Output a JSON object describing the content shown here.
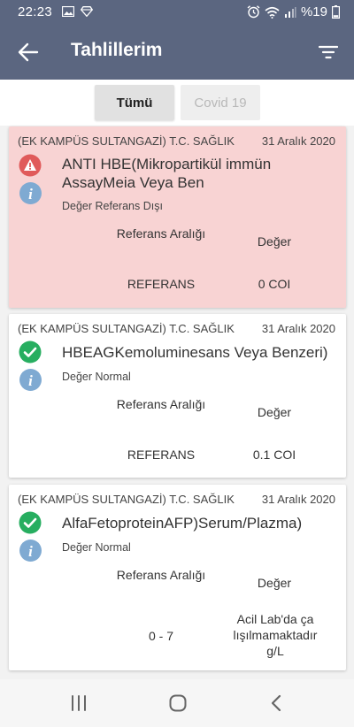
{
  "status_bar": {
    "time": "22:23",
    "battery_text": "%19",
    "icons": [
      "image-icon",
      "diamond-icon",
      "alarm-icon",
      "wifi-icon",
      "signal-icon",
      "battery-icon"
    ]
  },
  "header": {
    "title": "Tahlillerim",
    "back_icon": "arrow-left-icon",
    "filter_icon": "filter-icon"
  },
  "tabs": [
    {
      "label": "Tümü",
      "selected": true
    },
    {
      "label": "Covid 19",
      "selected": false
    }
  ],
  "colors": {
    "primary": "#5b6680",
    "alert_card_bg": "#f8d3d3",
    "warning_icon": "#e05a5a",
    "check_icon": "#27ae60",
    "info_icon": "#7faad2"
  },
  "results": [
    {
      "institution": "(EK KAMPÜS SULTANGAZİ) T.C. SAĞLIK",
      "date": "31 Aralık 2020",
      "test_name": "ANTI HBE(Mikropartikül immün AssayMeia Veya Ben",
      "status_text": "Değer Referans Dışı",
      "status_icon": "warning-icon",
      "ref_header": "Referans Aralığı",
      "value_header": "Değer",
      "ref_value": "REFERANS",
      "value": "0 COI"
    },
    {
      "institution": "(EK KAMPÜS SULTANGAZİ) T.C. SAĞLIK",
      "date": "31 Aralık 2020",
      "test_name": "HBEAGKemoluminesans Veya Benzeri)",
      "status_text": "Değer Normal",
      "status_icon": "check-circle-icon",
      "ref_header": "Referans Aralığı",
      "value_header": "Değer",
      "ref_value": "REFERANS",
      "value": "0.1 COI"
    },
    {
      "institution": "(EK KAMPÜS SULTANGAZİ) T.C. SAĞLIK",
      "date": "31 Aralık 2020",
      "test_name": "AlfaFetoproteinAFP)Serum/Plazma)",
      "status_text": "Değer Normal",
      "status_icon": "check-circle-icon",
      "ref_header": "Referans Aralığı",
      "value_header": "Değer",
      "ref_value": "0 - 7",
      "value": "Acil Lab'da ça lışılmamaktadır g/L"
    }
  ],
  "nav_bar": {
    "icons": [
      "recent-apps-icon",
      "home-icon",
      "back-nav-icon"
    ]
  }
}
